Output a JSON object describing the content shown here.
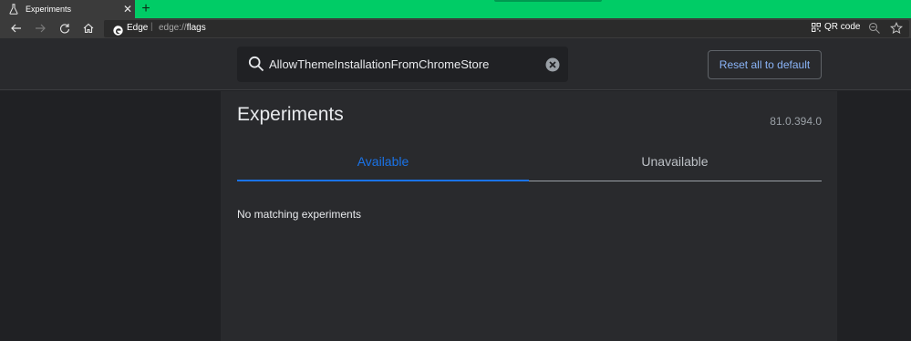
{
  "browser": {
    "tab_title": "Experiments",
    "omnibox_brand": "Edge",
    "url_scheme": "edge://",
    "url_path": "flags",
    "qr_label": "QR code"
  },
  "header": {
    "search_value": "AllowThemeInstallationFromChromeStore",
    "reset_label": "Reset all to default"
  },
  "main": {
    "title": "Experiments",
    "version": "81.0.394.0",
    "tabs": [
      {
        "label": "Available",
        "active": true
      },
      {
        "label": "Unavailable",
        "active": false
      }
    ],
    "empty_message": "No matching experiments"
  },
  "colors": {
    "tabstrip": "#00cc66",
    "accent": "#1a73e8",
    "link": "#8ab4f8",
    "background": "#202124",
    "surface": "#292a2d"
  },
  "icons": [
    "flask-icon",
    "close-icon",
    "new-tab-icon",
    "back-icon",
    "forward-icon",
    "refresh-icon",
    "home-icon",
    "edge-logo-icon",
    "qr-code-icon",
    "zoom-icon",
    "star-icon",
    "search-icon",
    "clear-icon"
  ]
}
